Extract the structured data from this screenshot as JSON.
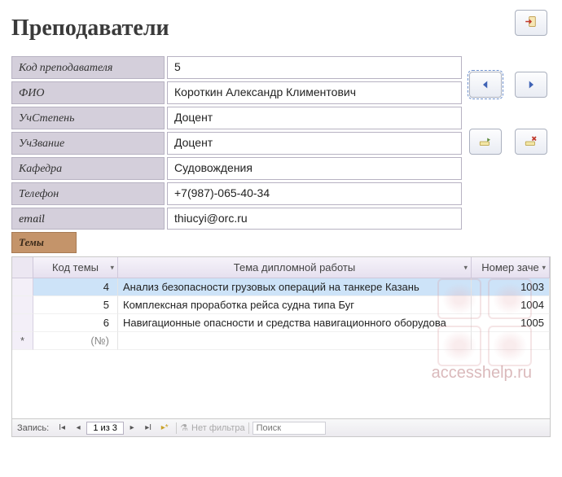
{
  "title": "Преподаватели",
  "fields": {
    "id_label": "Код преподавателя",
    "id_value": "5",
    "fio_label": "ФИО",
    "fio_value": "Короткин Александр Климентович",
    "degree_label": "УчСтепень",
    "degree_value": "Доцент",
    "rank_label": "УчЗвание",
    "rank_value": "Доцент",
    "dept_label": "Кафедра",
    "dept_value": "Судовождения",
    "phone_label": "Телефон",
    "phone_value": "+7(987)-065-40-34",
    "email_label": "email",
    "email_value": "thiucyi@orc.ru"
  },
  "themes_label": "Темы",
  "grid": {
    "headers": {
      "theme_id": "Код темы",
      "theme_title": "Тема дипломной работы",
      "record_no": "Номер заче"
    },
    "rows": [
      {
        "id": "4",
        "title": "Анализ безопасности грузовых операций на танкере Казань",
        "rec": "1003"
      },
      {
        "id": "5",
        "title": "Комплексная проработка рейса судна типа Буг",
        "rec": "1004"
      },
      {
        "id": "6",
        "title": "Навигационные опасности и средства навигационного оборудова",
        "rec": "1005"
      }
    ],
    "new_placeholder": "(№)"
  },
  "nav": {
    "record_label": "Запись:",
    "position": "1 из 3",
    "no_filter": "Нет фильтра",
    "search_placeholder": "Поиск"
  },
  "watermark": "accesshelp.ru"
}
